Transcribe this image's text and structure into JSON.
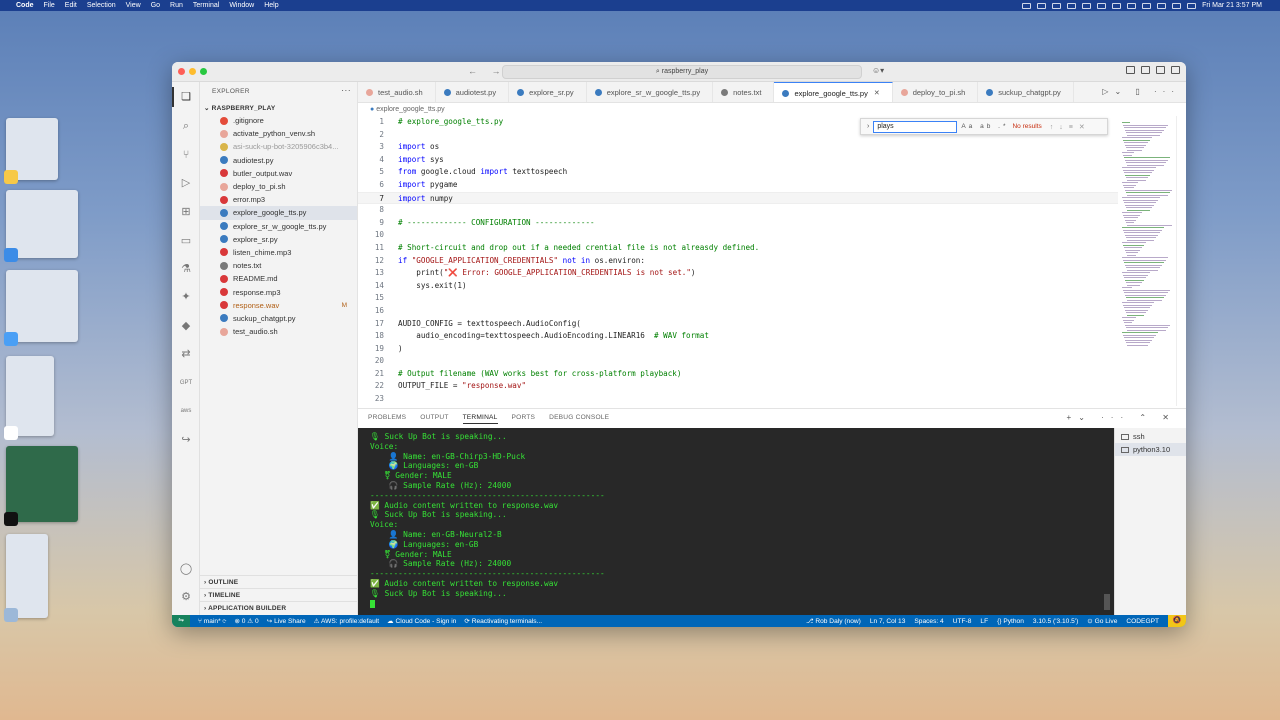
{
  "menubar": {
    "app": "Code",
    "items": [
      "File",
      "Edit",
      "Selection",
      "View",
      "Go",
      "Run",
      "Terminal",
      "Window",
      "Help"
    ],
    "clock": "Fri Mar 21  3:57 PM"
  },
  "window": {
    "command_center": "raspberry_play"
  },
  "explorer": {
    "title": "EXPLORER",
    "folder": "RASPBERRY_PLAY",
    "files": [
      {
        "name": ".gitignore",
        "icon": "git-icon",
        "color": "#e44c3a"
      },
      {
        "name": "activate_python_venv.sh",
        "icon": "shell-icon",
        "color": "#e8a69a"
      },
      {
        "name": "asi-suck-up-bot-3205906c3b4...",
        "icon": "json-icon",
        "color": "#d9b54a"
      },
      {
        "name": "audiotest.py",
        "icon": "python-icon",
        "color": "#3b7bbf"
      },
      {
        "name": "butler_output.wav",
        "icon": "audio-icon",
        "color": "#d9383a"
      },
      {
        "name": "deploy_to_pi.sh",
        "icon": "shell-icon",
        "color": "#e8a69a"
      },
      {
        "name": "error.mp3",
        "icon": "audio-icon",
        "color": "#d9383a"
      },
      {
        "name": "explore_google_tts.py",
        "icon": "python-icon",
        "color": "#3b7bbf"
      },
      {
        "name": "explore_sr_w_google_tts.py",
        "icon": "python-icon",
        "color": "#3b7bbf"
      },
      {
        "name": "explore_sr.py",
        "icon": "python-icon",
        "color": "#3b7bbf"
      },
      {
        "name": "listen_chime.mp3",
        "icon": "audio-icon",
        "color": "#d9383a"
      },
      {
        "name": "notes.txt",
        "icon": "text-icon",
        "color": "#7a7a7a"
      },
      {
        "name": "README.md",
        "icon": "markdown-icon",
        "color": "#d9383a"
      },
      {
        "name": "response.mp3",
        "icon": "audio-icon",
        "color": "#d9383a"
      },
      {
        "name": "response.wav",
        "icon": "audio-icon",
        "color": "#d9383a",
        "badge": "M"
      },
      {
        "name": "suckup_chatgpt.py",
        "icon": "python-icon",
        "color": "#3b7bbf"
      },
      {
        "name": "test_audio.sh",
        "icon": "shell-icon",
        "color": "#e8a69a"
      }
    ],
    "sections": [
      "OUTLINE",
      "TIMELINE",
      "APPLICATION BUILDER"
    ]
  },
  "tabs": [
    {
      "label": "test_audio.sh",
      "color": "#e8a69a"
    },
    {
      "label": "audiotest.py",
      "color": "#3b7bbf"
    },
    {
      "label": "explore_sr.py",
      "color": "#3b7bbf"
    },
    {
      "label": "explore_sr_w_google_tts.py",
      "color": "#3b7bbf"
    },
    {
      "label": "notes.txt",
      "color": "#7a7a7a"
    },
    {
      "label": "explore_google_tts.py",
      "color": "#3b7bbf",
      "active": true
    },
    {
      "label": "deploy_to_pi.sh",
      "color": "#e8a69a"
    },
    {
      "label": "suckup_chatgpt.py",
      "color": "#3b7bbf"
    }
  ],
  "breadcrumb": "explore_google_tts.py",
  "find": {
    "query": "plays",
    "result": "No results"
  },
  "code_lines": [
    {
      "n": "1",
      "html": "<span class='cm'># explore_google_tts.py</span>"
    },
    {
      "n": "2",
      "html": ""
    },
    {
      "n": "3",
      "html": "<span class='kw'>import</span> os"
    },
    {
      "n": "4",
      "html": "<span class='kw'>import</span> sys"
    },
    {
      "n": "5",
      "html": "<span class='kw'>from</span> google.cloud <span class='kw'>import</span> texttospeech"
    },
    {
      "n": "6",
      "html": "<span class='kw'>import</span> pygame"
    },
    {
      "n": "7",
      "html": "<span class='kw'>import</span> numpy",
      "current": true
    },
    {
      "n": "8",
      "html": ""
    },
    {
      "n": "9",
      "html": "<span class='cm'># ------------- CONFIGURATION -------------</span>"
    },
    {
      "n": "10",
      "html": ""
    },
    {
      "n": "11",
      "html": "<span class='cm'># Short-circuit and drop out if a needed crential file is not alreasdy defined.</span>"
    },
    {
      "n": "12",
      "html": "<span class='kw'>if</span> <span class='st'>\"GOOGLE_APPLICATION_CREDENTIALS\"</span> <span class='kw'>not in</span> os.environ:"
    },
    {
      "n": "13",
      "html": "    print(<span class='st'>\"❌ Error: GOOGLE_APPLICATION_CREDENTIALS is not set.\"</span>)"
    },
    {
      "n": "14",
      "html": "    sys.exit(1)"
    },
    {
      "n": "15",
      "html": ""
    },
    {
      "n": "16",
      "html": ""
    },
    {
      "n": "17",
      "html": "AUDIO_CONFIG = texttospeech.AudioConfig("
    },
    {
      "n": "18",
      "html": "    audio_encoding=texttospeech.AudioEncoding.LINEAR16  <span class='cm'># WAV format</span>"
    },
    {
      "n": "19",
      "html": ")"
    },
    {
      "n": "20",
      "html": ""
    },
    {
      "n": "21",
      "html": "<span class='cm'># Output filename (WAV works best for cross-platform playback)</span>"
    },
    {
      "n": "22",
      "html": "OUTPUT_FILE = <span class='st'>\"response.wav\"</span>"
    },
    {
      "n": "23",
      "html": ""
    }
  ],
  "panel": {
    "tabs": [
      "PROBLEMS",
      "OUTPUT",
      "TERMINAL",
      "PORTS",
      "DEBUG CONSOLE"
    ],
    "active": "TERMINAL"
  },
  "terminal_lines": [
    "🎙 Suck Up Bot is speaking...",
    "Voice:",
    "    👤 Name: en-GB-Chirp3-HD-Puck",
    "    🌍 Languages: en-GB",
    "   ⚧ Gender: MALE",
    "    🎧 Sample Rate (Hz): 24000",
    "--------------------------------------------------",
    "✅ Audio content written to response.wav",
    "🎙 Suck Up Bot is speaking...",
    "Voice:",
    "    👤 Name: en-GB-Neural2-B",
    "    🌍 Languages: en-GB",
    "   ⚧ Gender: MALE",
    "    🎧 Sample Rate (Hz): 24000",
    "--------------------------------------------------",
    "✅ Audio content written to response.wav",
    "🎙 Suck Up Bot is speaking..."
  ],
  "terminal_instances": [
    "ssh",
    "python3.10"
  ],
  "status": {
    "branch": "main*",
    "problems": "⊗ 0 ⚠ 0",
    "liveshare": "Live Share",
    "aws": "AWS: profile:default",
    "cloudcode": "Cloud Code - Sign in",
    "reactivating": "Reactivating terminals...",
    "author": "Rob Daly (now)",
    "position": "Ln 7, Col 13",
    "spaces": "Spaces: 4",
    "encoding": "UTF-8",
    "eol": "LF",
    "language": "Python",
    "version": "3.10.5 ('3.10.5')",
    "golive": "Go Live",
    "codegpt": "CODEGPT"
  }
}
